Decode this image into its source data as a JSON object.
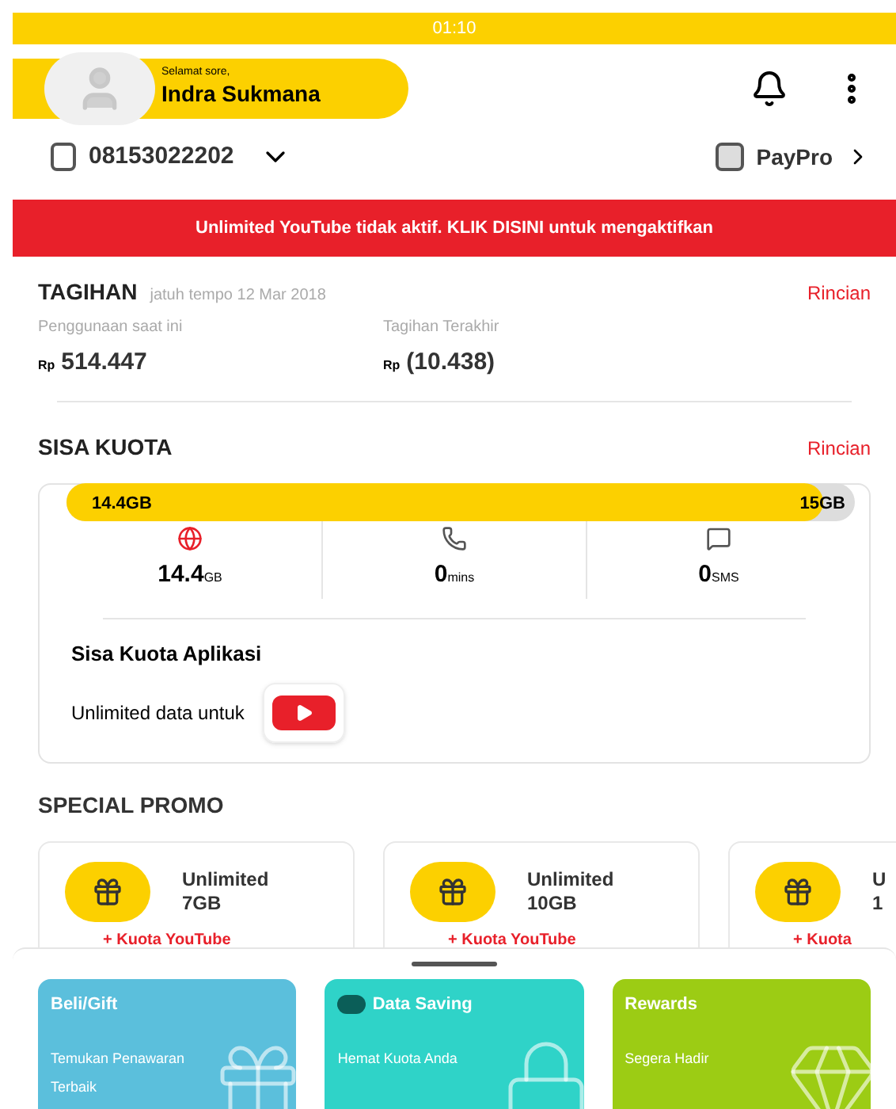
{
  "status_bar": {
    "time": "01:10"
  },
  "header": {
    "greeting": "Selamat sore,",
    "name": "Indra Sukmana"
  },
  "account": {
    "number": "08153022202",
    "paypro": "PayPro"
  },
  "banner": "Unlimited YouTube tidak aktif. KLIK DISINI untuk mengaktifkan",
  "billing": {
    "title": "TAGIHAN",
    "due": "jatuh tempo 12 Mar 2018",
    "link": "Rincian",
    "items": [
      {
        "label": "Penggunaan saat ini",
        "currency": "Rp",
        "amount": "514.447"
      },
      {
        "label": "Tagihan Terakhir",
        "currency": "Rp",
        "amount": "(10.438)"
      }
    ]
  },
  "quota": {
    "title": "SISA KUOTA",
    "link": "Rincian",
    "used": "14.4GB",
    "total": "15GB",
    "level": 0.96,
    "items": [
      {
        "kind": "data",
        "value": "14.4",
        "unit": "GB"
      },
      {
        "kind": "call",
        "value": "0",
        "unit": "mins"
      },
      {
        "kind": "sms",
        "value": "0",
        "unit": "SMS"
      }
    ],
    "app_title": "Sisa Kuota Aplikasi",
    "app_text": "Unlimited data untuk"
  },
  "promo": {
    "title": "SPECIAL PROMO",
    "cards": [
      {
        "name": "Unlimited",
        "size": "7GB",
        "extra": "+ Kuota YouTube"
      },
      {
        "name": "Unlimited",
        "size": "10GB",
        "extra": "+ Kuota YouTube"
      },
      {
        "name": "U",
        "size": "1",
        "extra": "+ Kuota"
      }
    ]
  },
  "tiles": [
    {
      "kind": "gift",
      "title": "Beli/Gift",
      "text": "Temukan Penawaran Terbaik",
      "color": "#5bbfdc"
    },
    {
      "kind": "lock",
      "title": "Data Saving",
      "text": "Hemat Kuota Anda",
      "color": "#2fd3c8"
    },
    {
      "kind": "diamond",
      "title": "Rewards",
      "text": "Segera Hadir",
      "color": "#9ccc14"
    }
  ]
}
